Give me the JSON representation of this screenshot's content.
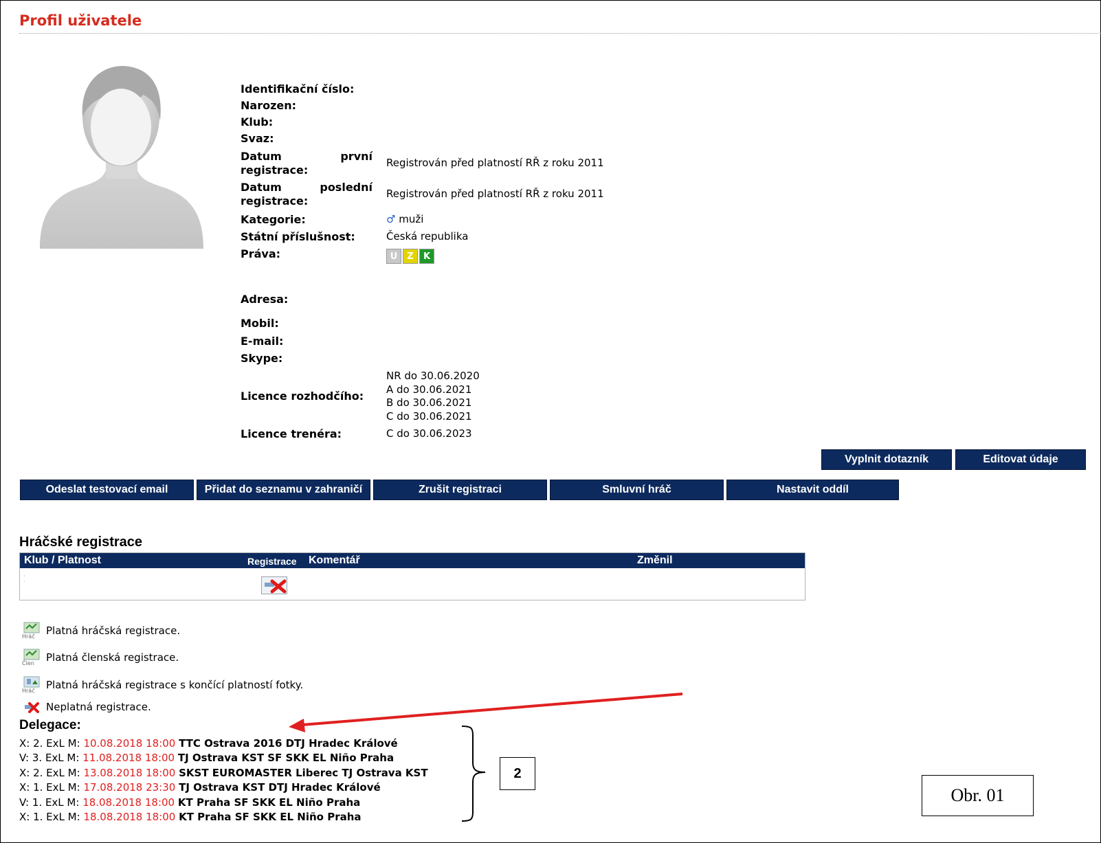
{
  "page": {
    "title": "Profil uživatele"
  },
  "profile": {
    "id_label": "Identifikační číslo:",
    "born_label": "Narozen:",
    "club_label": "Klub:",
    "union_label": "Svaz:",
    "first_reg_label_1": "Datum",
    "first_reg_label_2": "první",
    "first_reg_label_3": "registrace:",
    "first_reg_value": "Registrován před platností RŘ z roku 2011",
    "last_reg_label_1": "Datum",
    "last_reg_label_2": "poslední",
    "last_reg_label_3": "registrace:",
    "last_reg_value": "Registrován před platností RŘ z roku 2011",
    "category_label": "Kategorie:",
    "category_symbol": "♂",
    "category_value": "muži",
    "nationality_label": "Státní příslušnost:",
    "nationality_value": "Česká republika",
    "rights_label": "Práva:",
    "rights": [
      {
        "letter": "U",
        "color": "#c8c8c8"
      },
      {
        "letter": "Z",
        "color": "#e3d400"
      },
      {
        "letter": "K",
        "color": "#1f9a2a"
      }
    ],
    "address_label": "Adresa:",
    "mobile_label": "Mobil:",
    "email_label": "E-mail:",
    "skype_label": "Skype:",
    "referee_label": "Licence rozhodčího:",
    "referee_lines": [
      "NR do 30.06.2020",
      "A do 30.06.2021",
      "B do 30.06.2021",
      "C do 30.06.2021"
    ],
    "coach_label": "Licence trenéra:",
    "coach_value": "C do 30.06.2023"
  },
  "buttons": {
    "questionnaire": "Vyplnit dotazník",
    "edit": "Editovat údaje",
    "send_test_email": "Odeslat testovací email",
    "add_abroad": "Přidat do seznamu v zahraničí",
    "cancel_registration": "Zrušit registraci",
    "contract_player": "Smluvní hráč",
    "set_department": "Nastavit oddíl"
  },
  "registrations": {
    "title": "Hráčské registrace",
    "columns": [
      "Klub / Platnost",
      "Registrace",
      "Komentář",
      "Změnil"
    ]
  },
  "legend": [
    {
      "icon": "player-registration-icon",
      "caption": "Hráč",
      "text": "Platná hráčská registrace."
    },
    {
      "icon": "member-registration-icon",
      "caption": "Člen",
      "text": "Platná členská registrace."
    },
    {
      "icon": "photo-expiring-icon",
      "caption": "Hráč",
      "text": "Platná hráčská registrace s končící platností fotky."
    },
    {
      "icon": "invalid-registration-icon",
      "caption": "",
      "text": "Neplatná registrace."
    }
  ],
  "delegations": {
    "title": "Delegace:",
    "items": [
      {
        "prefix": "X: 2. ExL M:",
        "datetime": "10.08.2018 18:00",
        "match": "TTC Ostrava 2016 DTJ Hradec Králové"
      },
      {
        "prefix": "V: 3. ExL M:",
        "datetime": "11.08.2018 18:00",
        "match": "TJ Ostrava KST SF SKK EL Niño Praha"
      },
      {
        "prefix": "X: 2. ExL M:",
        "datetime": "13.08.2018 18:00",
        "match": "SKST EUROMASTER Liberec TJ Ostrava KST"
      },
      {
        "prefix": "X: 1. ExL M:",
        "datetime": "17.08.2018 23:30",
        "match": "TJ Ostrava KST DTJ Hradec Králové"
      },
      {
        "prefix": "V: 1. ExL M:",
        "datetime": "18.08.2018 18:00",
        "match": "KT Praha SF SKK EL Niño Praha"
      },
      {
        "prefix": "X: 1. ExL M:",
        "datetime": "18.08.2018 18:00",
        "match": "KT Praha SF SKK EL Niño Praha"
      }
    ]
  },
  "annotations": {
    "marker": "2",
    "figure": "Obr. 01"
  },
  "colors": {
    "title_red": "#d52b1e",
    "navy": "#0d2a5e",
    "date_red": "#e02020"
  }
}
